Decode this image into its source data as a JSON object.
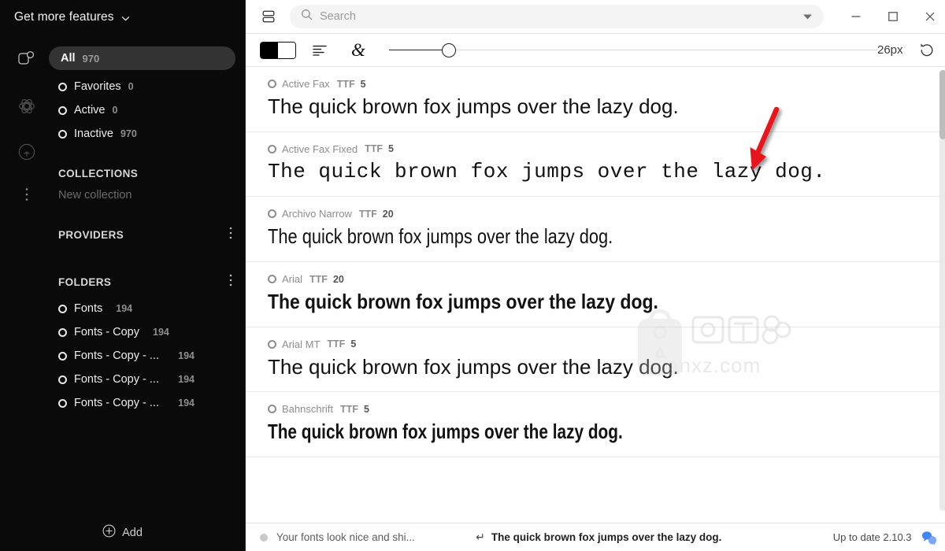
{
  "sidebar": {
    "get_more_features": "Get more features",
    "rail_icons": [
      "library-icon",
      "playground-icon",
      "broadcast-icon",
      "more-options-icon"
    ],
    "filters": [
      {
        "label": "All",
        "count": "970",
        "selected": true,
        "icon": ""
      },
      {
        "label": "Favorites",
        "count": "0",
        "selected": false,
        "icon": "circle-icon"
      },
      {
        "label": "Active",
        "count": "0",
        "selected": false,
        "icon": "circle-icon"
      },
      {
        "label": "Inactive",
        "count": "970",
        "selected": false,
        "icon": "circle-icon"
      }
    ],
    "collections": {
      "title": "COLLECTIONS",
      "new_collection": "New collection"
    },
    "providers": {
      "title": "PROVIDERS"
    },
    "folders": {
      "title": "FOLDERS",
      "items": [
        {
          "label": "Fonts",
          "count": "194"
        },
        {
          "label": "Fonts - Copy",
          "count": "194"
        },
        {
          "label": "Fonts - Copy - ...",
          "count": "194"
        },
        {
          "label": "Fonts - Copy - ...",
          "count": "194"
        },
        {
          "label": "Fonts - Copy - ...",
          "count": "194"
        }
      ]
    },
    "add_button": "Add"
  },
  "titlebar": {
    "panel_toggle_icon": "panel-layout-icon",
    "search_placeholder": "Search",
    "search_value": "",
    "search_icon": "search-icon",
    "dropdown_icon": "caret-down-icon",
    "minimize": "minimize-icon",
    "maximize": "maximize-icon",
    "close": "close-icon"
  },
  "toolbar": {
    "bw_toggle_icon": "black-white-contrast-toggle",
    "align_icon": "text-align-left-icon",
    "glyph_icon": "ampersand-icon",
    "glyph_char": "&",
    "slider_value": 26,
    "slider_min": 8,
    "slider_max": 200,
    "size_label": "26px",
    "reset_icon": "reset-rotate-icon"
  },
  "fonts": {
    "rows": [
      {
        "name": "Active Fax",
        "format": "TTF",
        "count": "5",
        "sample": "The quick brown fox jumps over the lazy dog.",
        "style": "s-sans"
      },
      {
        "name": "Active Fax Fixed",
        "format": "TTF",
        "count": "5",
        "sample": "The quick brown fox jumps over the lazy dog.",
        "style": "s-mono"
      },
      {
        "name": "Archivo Narrow",
        "format": "TTF",
        "count": "20",
        "sample": "The quick brown fox jumps over the lazy dog.",
        "style": "s-narrow"
      },
      {
        "name": "Arial",
        "format": "TTF",
        "count": "20",
        "sample": "The quick brown fox jumps over the lazy dog.",
        "style": "s-bold-narrow"
      },
      {
        "name": "Arial MT",
        "format": "TTF",
        "count": "5",
        "sample": "The quick brown fox jumps over the lazy dog.",
        "style": "s-sans"
      },
      {
        "name": "Bahnschrift",
        "format": "TTF",
        "count": "5",
        "sample": "The quick brown fox jumps over the lazy dog.",
        "style": "s-cond"
      }
    ]
  },
  "status": {
    "left_text": "Your fonts look nice and shi...",
    "preview_text": "The quick brown fox jumps over the lazy dog.",
    "return_glyph": "↵",
    "version_text": "Up to date 2.10.3",
    "chat_icon": "chat-bubble-icon"
  },
  "watermark": {
    "text": "anxz.com"
  },
  "annotation": {
    "arrow": "red-arrow-pointing-down-left"
  },
  "colors": {
    "sidebar_bg": "#0a0a0a",
    "pill_bg": "#333333",
    "accent_red": "#e8191b",
    "chat_blue": "#4285f4",
    "divider": "#e8e8e8"
  }
}
